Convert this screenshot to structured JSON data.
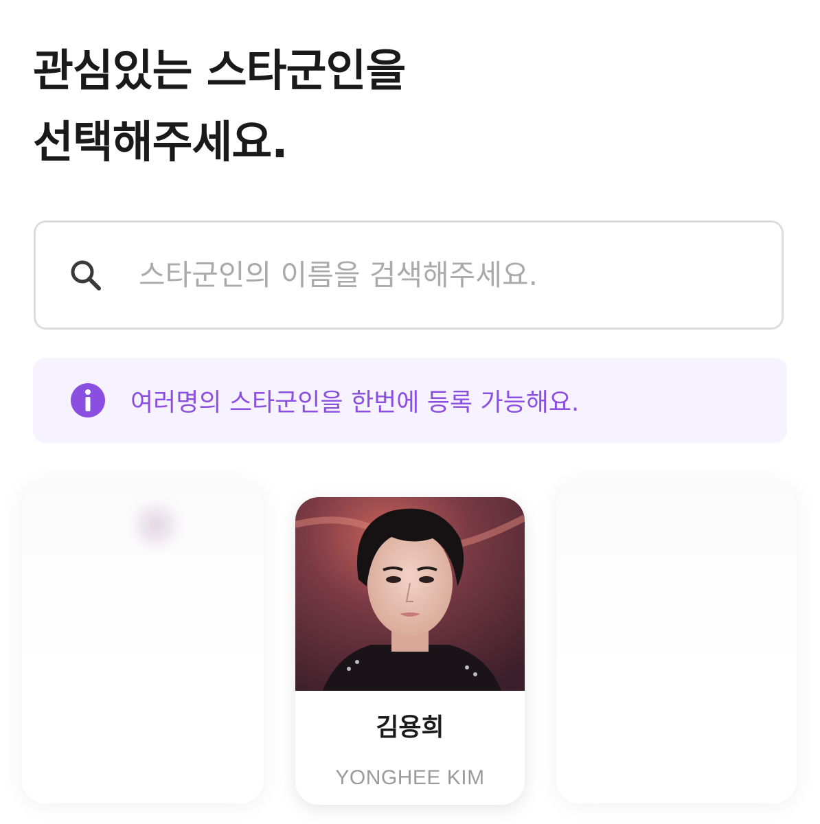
{
  "header": {
    "title_line1": "관심있는 스타군인을",
    "title_line2": "선택해주세요."
  },
  "search": {
    "placeholder": "스타군인의 이름을 검색해주세요.",
    "value": "",
    "icon": "search-icon"
  },
  "notice": {
    "icon": "info-icon",
    "text": "여러명의 스타군인을 한번에 등록 가능해요.",
    "color": "#8a4fe0",
    "background": "#f6f2ff"
  },
  "cards": [
    {
      "name": "김용희",
      "english_name": "YONGHEE KIM",
      "selected": false
    }
  ],
  "colors": {
    "title": "#1a1a1a",
    "placeholder": "#aaaaaa",
    "card_sub": "#9a9a9a"
  }
}
